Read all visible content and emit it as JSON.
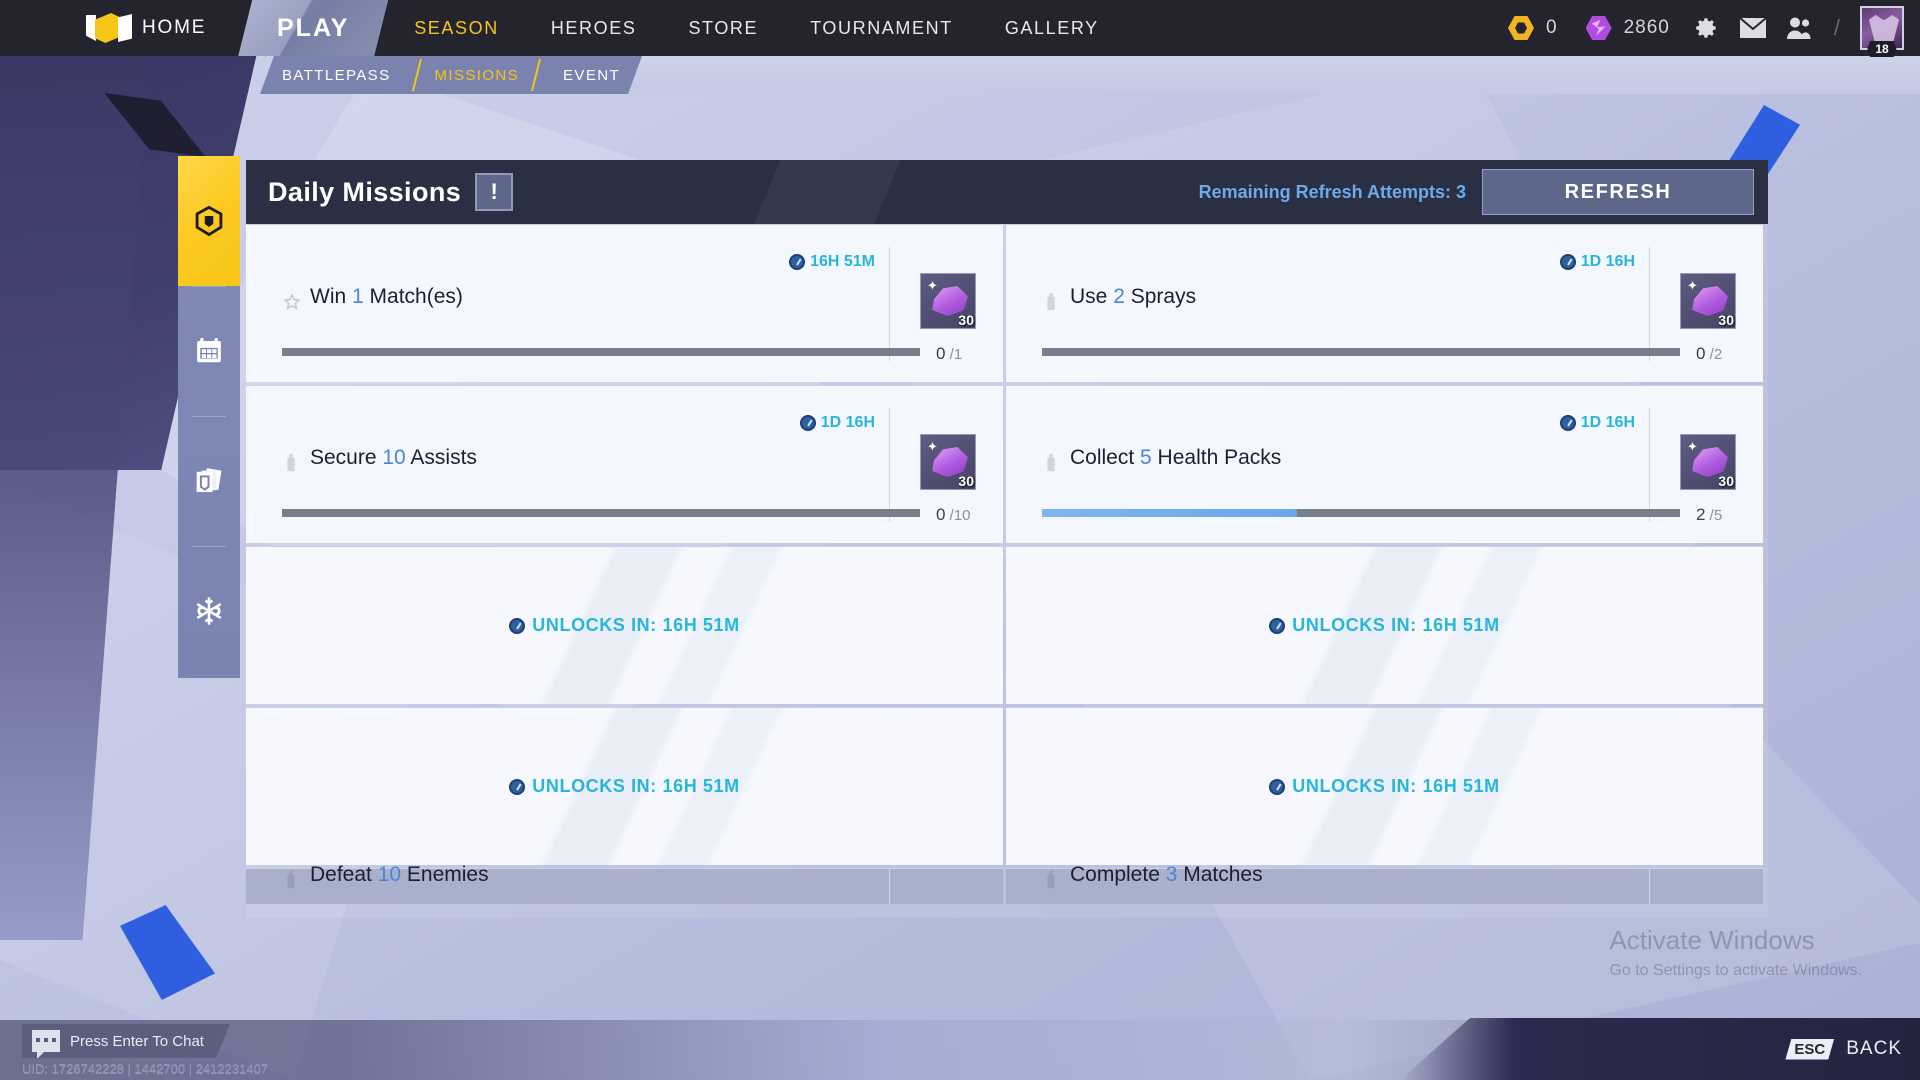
{
  "topnav": {
    "logo_icon": "game-logo-icon",
    "home_label": "HOME",
    "play_label": "PLAY",
    "items": [
      {
        "label": "SEASON",
        "accent": true
      },
      {
        "label": "HEROES",
        "accent": false
      },
      {
        "label": "STORE",
        "accent": false
      },
      {
        "label": "TOURNAMENT",
        "accent": false
      },
      {
        "label": "GALLERY",
        "accent": false
      }
    ],
    "currencies": [
      {
        "icon": "coin-icon",
        "value": "0"
      },
      {
        "icon": "gem-icon",
        "value": "2860"
      }
    ],
    "slash": "/",
    "icons": [
      "gear-icon",
      "mail-icon",
      "friends-icon"
    ],
    "avatar": {
      "icon": "avatar",
      "level": "18"
    }
  },
  "subnav": {
    "tabs": [
      {
        "label": "BATTLEPASS",
        "active": false
      },
      {
        "label": "MISSIONS",
        "active": true
      },
      {
        "label": "EVENT",
        "active": false
      }
    ]
  },
  "sidebar": {
    "items": [
      {
        "icon": "battlepass-icon",
        "active": true
      },
      {
        "icon": "calendar-icon",
        "active": false
      },
      {
        "icon": "cards-icon",
        "active": false
      },
      {
        "icon": "snowflake-icon",
        "active": false
      }
    ]
  },
  "panel": {
    "title": "Daily Missions",
    "badge": "!",
    "refresh_label": "Remaining Refresh Attempts: 3",
    "refresh_button": "REFRESH"
  },
  "missions": [
    {
      "icon": "star-icon",
      "prefix": "Win ",
      "amount": "1",
      "suffix": " Match(es)",
      "timer": "16H 51M",
      "progress_current": "0",
      "progress_sep": "/",
      "progress_total": "1",
      "progress_pct": 0,
      "reward_qty": "30",
      "reward_icon": "gem-stack-icon"
    },
    {
      "icon": "spray-icon",
      "prefix": "Use ",
      "amount": "2",
      "suffix": " Sprays",
      "timer": "1D 16H",
      "progress_current": "0",
      "progress_sep": "/",
      "progress_total": "2",
      "progress_pct": 0,
      "reward_qty": "30",
      "reward_icon": "gem-stack-icon"
    },
    {
      "icon": "assist-icon",
      "prefix": "Secure ",
      "amount": "10",
      "suffix": " Assists",
      "timer": "1D 16H",
      "progress_current": "0",
      "progress_sep": "/",
      "progress_total": "10",
      "progress_pct": 0,
      "reward_qty": "30",
      "reward_icon": "gem-stack-icon"
    },
    {
      "icon": "healthpack-icon",
      "prefix": "Collect ",
      "amount": "5",
      "suffix": " Health Packs",
      "timer": "1D 16H",
      "progress_current": "2",
      "progress_sep": "/",
      "progress_total": "5",
      "progress_pct": 40,
      "reward_qty": "30",
      "reward_icon": "gem-stack-icon"
    }
  ],
  "locked": [
    {
      "label": "UNLOCKS IN: 16H 51M"
    },
    {
      "label": "UNLOCKS IN: 16H 51M"
    },
    {
      "label": "UNLOCKS IN: 16H 51M"
    },
    {
      "label": "UNLOCKS IN: 16H 51M"
    }
  ],
  "cut_missions": [
    {
      "icon": "defeat-icon",
      "prefix": "Defeat ",
      "amount": "10",
      "suffix": " Enemies"
    },
    {
      "icon": "match-icon",
      "prefix": "Complete ",
      "amount": "3",
      "suffix": " Matches"
    }
  ],
  "footer": {
    "chat_label": "Press Enter To Chat",
    "chat_icon": "chat-icon",
    "uid": "UID: 1726742228 | 1442700 | 2412231407",
    "esc_key": "ESC",
    "esc_label": "BACK"
  },
  "watermark": {
    "line1": "Activate Windows",
    "line2": "Go to Settings to activate Windows."
  },
  "colors": {
    "accent_yellow": "#f5c518",
    "timer_cyan": "#27b5dc",
    "link_blue": "#6fa9e8",
    "panel_dark": "#2b2f44",
    "progress_blue": "#7fb6f0"
  }
}
